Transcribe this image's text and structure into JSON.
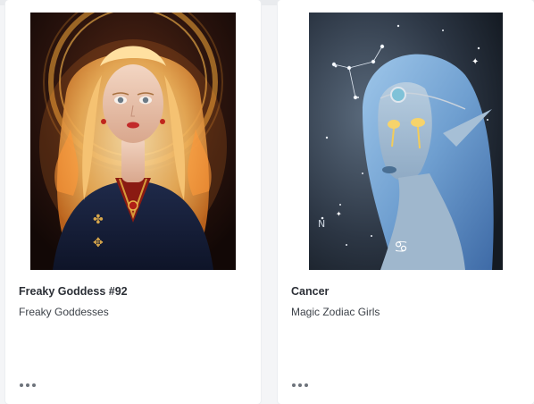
{
  "cards": [
    {
      "title": "Freaky Goddess #92",
      "collection": "Freaky Goddesses",
      "image": "fantasy-portrait-blonde-goddess-with-golden-halo",
      "more_icon": "ellipsis-icon"
    },
    {
      "title": "Cancer",
      "collection": "Magic Zodiac Girls",
      "image": "illustration-blue-haired-elf-with-cancer-zodiac-sign",
      "more_icon": "ellipsis-icon"
    }
  ],
  "colors": {
    "card_bg": "#ffffff",
    "page_bg": "#f4f5f7",
    "title": "#2b2f36",
    "subtitle": "#3d4249"
  }
}
